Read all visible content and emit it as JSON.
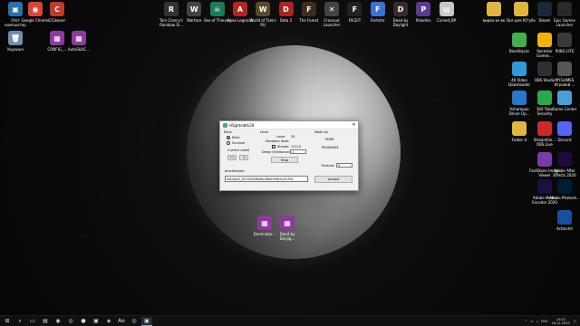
{
  "desktop_icons_left": [
    {
      "label": "Этот компьютер",
      "icon": "computer-icon",
      "color": "#2a6fb3",
      "glyph": "▣"
    },
    {
      "label": "Google Chrome",
      "icon": "chrome-icon",
      "color": "#db4437",
      "glyph": "◉"
    },
    {
      "label": "CCleaner",
      "icon": "ccleaner-icon",
      "color": "#c0392b",
      "glyph": "C"
    },
    {
      "label": "Корзина",
      "icon": "recycle-bin-icon",
      "color": "#6a8fb3",
      "glyph": "🗑"
    },
    {
      "label": "CONFIG_...",
      "icon": "archive-icon",
      "color": "#8e3a9e",
      "glyph": "▦"
    },
    {
      "label": "AutoSkillC...",
      "icon": "archive-icon",
      "color": "#8e3a9e",
      "glyph": "▦"
    }
  ],
  "desktop_icons_top": [
    {
      "label": "Tom Clancy's Rainbow Si...",
      "icon": "rainbow-six-icon",
      "color": "#333333",
      "glyph": "R"
    },
    {
      "label": "Warface",
      "icon": "warface-icon",
      "color": "#444444",
      "glyph": "W"
    },
    {
      "label": "Sea of Thieves",
      "icon": "sea-of-thieves-icon",
      "color": "#1d7a5a",
      "glyph": "☠"
    },
    {
      "label": "Apex Legends",
      "icon": "apex-icon",
      "color": "#b3261e",
      "glyph": "A"
    },
    {
      "label": "World of Tanks RU",
      "icon": "wot-icon",
      "color": "#5a4a2a",
      "glyph": "W"
    },
    {
      "label": "Dota 2",
      "icon": "dota-icon",
      "color": "#a8241d",
      "glyph": "D"
    },
    {
      "label": "The Forest",
      "icon": "forest-icon",
      "color": "#3c2d1e",
      "glyph": "F"
    },
    {
      "label": "Crossout Launcher",
      "icon": "crossout-icon",
      "color": "#444444",
      "glyph": "✕"
    },
    {
      "label": "FACEIT",
      "icon": "faceit-icon",
      "color": "#222222",
      "glyph": "F"
    },
    {
      "label": "Fortnite",
      "icon": "fortnite-icon",
      "color": "#3d6fd8",
      "glyph": "F"
    },
    {
      "label": "Dead by Daylight",
      "icon": "dbd-icon",
      "color": "#3a2b2b",
      "glyph": "D"
    },
    {
      "label": "Paladins",
      "icon": "paladins-icon",
      "color": "#5b3b8e",
      "glyph": "P"
    },
    {
      "label": "Cursed_BP",
      "icon": "image-icon",
      "color": "#c8c8c8",
      "glyph": "▤"
    }
  ],
  "desktop_icons_center": [
    {
      "label": "Dominator...",
      "icon": "archive-icon",
      "color": "#8e3a9e",
      "glyph": "▦"
    },
    {
      "label": "Dead by Daylig...",
      "icon": "archive-icon",
      "color": "#8e3a9e",
      "glyph": "▦"
    }
  ],
  "desktop_icons_right": [
    {
      "label": "видео из вк",
      "icon": "folder-icon",
      "color": "#e0b640"
    },
    {
      "label": "Все для Ютуба",
      "icon": "folder-icon",
      "color": "#e0b640"
    },
    {
      "label": "Steam",
      "icon": "steam-icon",
      "color": "#1b2838"
    },
    {
      "label": "Epic Games Launcher",
      "icon": "epic-icon",
      "color": "#2a2a2a"
    },
    {
      "label": "BlueStacks",
      "icon": "bluestacks-icon",
      "color": "#44b04a"
    },
    {
      "label": "Rockstar Games...",
      "icon": "rockstar-icon",
      "color": "#f2b200"
    },
    {
      "label": "PUBG LITE",
      "icon": "pubg-icon",
      "color": "#3a3a3a"
    },
    {
      "label": "4K Video Downloader",
      "icon": "4k-icon",
      "color": "#2f9ad6"
    },
    {
      "label": "OBS Studio",
      "icon": "obs-icon",
      "color": "#302e31"
    },
    {
      "label": "MY.GAMES Игровой ...",
      "icon": "mygames-icon",
      "color": "#555555"
    },
    {
      "label": "Ashampoo Driver Up...",
      "icon": "ashampoo-icon",
      "color": "#2878c8"
    },
    {
      "label": "360 Total Security",
      "icon": "360-icon",
      "color": "#2aa84a"
    },
    {
      "label": "Game Center",
      "icon": "gamecenter-icon",
      "color": "#4a9fd8"
    },
    {
      "label": "Folder it",
      "icon": "folder-icon",
      "color": "#e0b640"
    },
    {
      "label": "StreamEle... OBS.Live",
      "icon": "streamelements-icon",
      "color": "#cc2a2a"
    },
    {
      "label": "Discord",
      "icon": "discord-icon",
      "color": "#5865f2"
    },
    {
      "label": "FastStone Image Viewer",
      "icon": "faststone-icon",
      "color": "#7a3aa8"
    },
    {
      "label": "Adobe After Effects 2020",
      "icon": "ae-icon",
      "color": "#1f0740"
    },
    {
      "label": "Adobe Media Encoder 2020",
      "icon": "me-icon",
      "color": "#1a1140"
    },
    {
      "label": "Adobe Photosh...",
      "icon": "ps-icon",
      "color": "#001d34"
    },
    {
      "label": "ActionInt",
      "icon": "actionint-icon",
      "color": "#1a4ea0"
    }
  ],
  "dialog": {
    "title": "HSgbteibtk28",
    "rank_group": "Rank",
    "radio_killer": "Killer",
    "radio_survivor": "Survivor",
    "current_rank_label": "Current rank:",
    "current_rank_value": "0",
    "btn_plus2": "+2",
    "btn_minus2": "-2",
    "level_group": "Level",
    "level_label": "Level:",
    "level_value": "35",
    "devotion_label": "Devotion level:",
    "shards_label": "Shards:",
    "shards_value": "11110",
    "delay_label": "Delay (milliseconds):",
    "delay_value": "1",
    "stop_button": "Stop",
    "made_by_group": "Made by",
    "made_by_1": "PDVR",
    "made_by_2": "PE4DN4K4",
    "timeout_label": "Timeout:",
    "timeout_value": "5",
    "bhvr_session_label": "bhvrSession:",
    "bhvr_session_value": "5sDQJxS_ECOSDDNsf8JLfBaKVMjHLaFLFAz",
    "accept_button": "Accept"
  },
  "taskbar": {
    "items": [
      {
        "icon": "windows-start-icon",
        "glyph": "⊞"
      },
      {
        "icon": "search-icon",
        "glyph": "⌕"
      },
      {
        "icon": "task-view-icon",
        "glyph": "▭"
      },
      {
        "icon": "explorer-icon",
        "glyph": "▤"
      },
      {
        "icon": "chrome-icon",
        "glyph": "◉"
      },
      {
        "icon": "steam-icon",
        "glyph": "◎"
      },
      {
        "icon": "obs-icon",
        "glyph": "●"
      },
      {
        "icon": "app-icon",
        "glyph": "▣"
      },
      {
        "icon": "app-icon",
        "glyph": "◈"
      },
      {
        "icon": "ae-icon",
        "glyph": "Ae"
      },
      {
        "icon": "steam-icon",
        "glyph": "◎"
      },
      {
        "icon": "hack-tool-icon",
        "glyph": "▣"
      }
    ],
    "language": "ENG",
    "time": "19:03",
    "date": "18.12.2020"
  }
}
